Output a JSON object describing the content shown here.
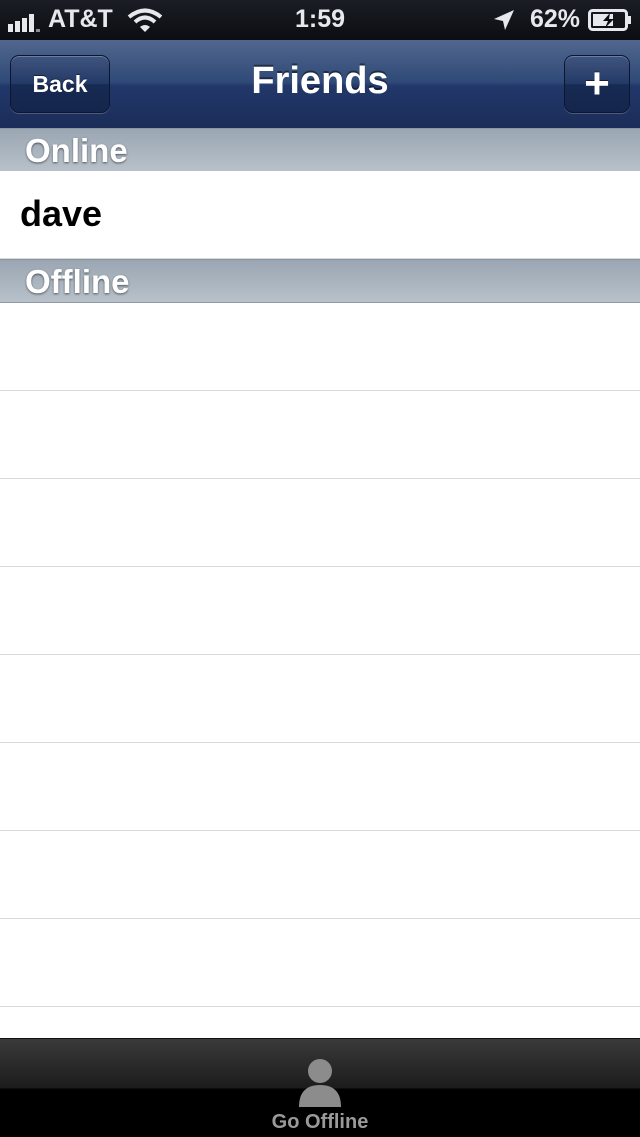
{
  "status_bar": {
    "carrier": "AT&T",
    "time": "1:59",
    "battery_percent": "62%",
    "icons": [
      "signal-icon",
      "wifi-icon",
      "location-arrow-icon",
      "battery-charging-icon"
    ]
  },
  "nav": {
    "title": "Friends",
    "back_label": "Back",
    "add_label": "+"
  },
  "sections": {
    "online": {
      "title": "Online",
      "friends": [
        "dave"
      ]
    },
    "offline": {
      "title": "Offline",
      "friends": [
        "",
        "",
        "",
        "",
        "",
        "",
        "",
        ""
      ]
    }
  },
  "tab_bar": {
    "items": [
      {
        "label": "Go Offline",
        "icon": "person-icon"
      }
    ]
  },
  "colors": {
    "nav_bar": "#2f4a77",
    "section_header": "#b0bac4",
    "tab_bar": "#000000"
  }
}
